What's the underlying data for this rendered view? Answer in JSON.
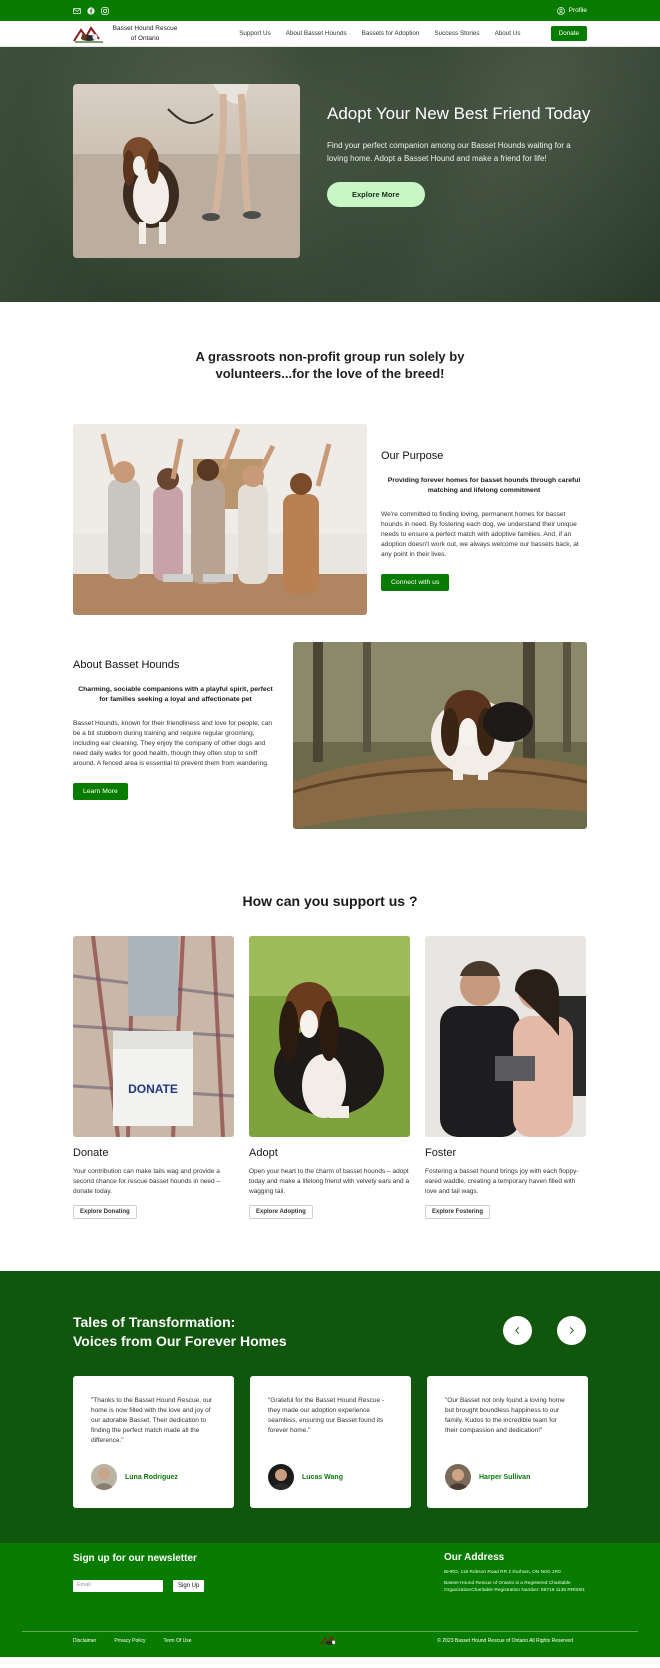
{
  "colors": {
    "brand_green": "#087c00",
    "dark_green": "#10560c",
    "explore_button": "#c7f7c4"
  },
  "topbar": {
    "icons": [
      "mail-icon",
      "facebook-icon",
      "instagram-icon"
    ],
    "profile_label": "Profile"
  },
  "nav": {
    "brand_name": "Basset Hound Rescue of Ontario",
    "links": [
      "Support Us",
      "About Basset Hounds",
      "Bassets for Adoption",
      "Success Stories",
      "About Us"
    ],
    "donate_label": "Donate"
  },
  "hero": {
    "title": "Adopt Your New Best Friend Today",
    "subtitle": "Find your perfect companion among our Basset Hounds waiting for a loving home. Adopt a Basset Hound and make a friend for life!",
    "button_label": "Explore More"
  },
  "mission": "A grassroots non-profit group run solely by volunteers...for the love of the breed!",
  "purpose": {
    "heading": "Our Purpose",
    "lead": "Providing forever homes for basset hounds through careful matching and lifelong commitment",
    "body": "We're committed to finding loving, permanent homes for basset hounds in need. By fostering each dog, we understand their unique needs to ensure a perfect match with adoptive families. And, if an adoption doesn't work out, we always welcome our bassets back, at any point in their lives.",
    "button_label": "Connect with us"
  },
  "about": {
    "heading": "About Basset Hounds",
    "lead": "Charming, sociable companions with a playful spirit, perfect for families seeking a loyal and affectionate pet",
    "body": "Basset Hounds, known for their friendliness and love for people, can be a bit stubborn during training and require regular grooming, including ear cleaning. They enjoy the company of other dogs and need daily walks for good health, though they often stop to sniff around. A fenced area is essential to prevent them from wandering.",
    "button_label": "Learn More"
  },
  "support": {
    "title": "How can you support us ?",
    "cards": [
      {
        "title": "Donate",
        "text": "Your contribution can make tails wag and provide a second chance for rescue basset hounds in need – donate today.",
        "button": "Explore Donating",
        "image_caption": "DONATE"
      },
      {
        "title": "Adopt",
        "text": "Open your heart to the charm of basset hounds – adopt today and make a lifelong friend with velvety ears and a wagging tail.",
        "button": "Explore Adopting"
      },
      {
        "title": "Foster",
        "text": "Fostering a basset hound brings joy with each floppy-eared waddle, creating a temporary haven filled with love and tail wags.",
        "button": "Explore Fostering"
      }
    ]
  },
  "testimonials": {
    "title_line1": "Tales of Transformation:",
    "title_line2": "Voices from Our Forever Homes",
    "items": [
      {
        "quote": "\"Thanks to the Basset Hound Rescue, our home is now filled with the love and joy of our adorable Basset. Their dedication to finding the perfect match made all the difference.\"",
        "name": "Luna Rodriguez"
      },
      {
        "quote": "\"Grateful for the Basset Hound Rescue - they made our adoption experience seamless, ensuring our Basset found its forever home.\"",
        "name": "Lucas Wang"
      },
      {
        "quote": "\"Our Basset not only found a loving home but brought boundless happiness to our family. Kudos to the incredible team for their compassion and dedication!\"",
        "name": "Harper Sullivan"
      }
    ]
  },
  "footer": {
    "newsletter_heading": "Sign up for our newsletter",
    "email_placeholder": "Email",
    "signup_label": "Sign Up",
    "address_heading": "Our Address",
    "address_line1": "BHRO, 118 Robson Road RR 2 Durham, ON  N0G 1R0",
    "address_line2": "Basset Hound Rescue of Ontario is a Registered Charitable OrganizationCharitable Registration Number: 85718 1135 RR0001",
    "links": [
      "Disclaimer",
      "Privacy Policy",
      "Term Of Use"
    ],
    "copyright": "© 2023 Basset Hound Rescue of Ontario All Rights Reserved"
  }
}
